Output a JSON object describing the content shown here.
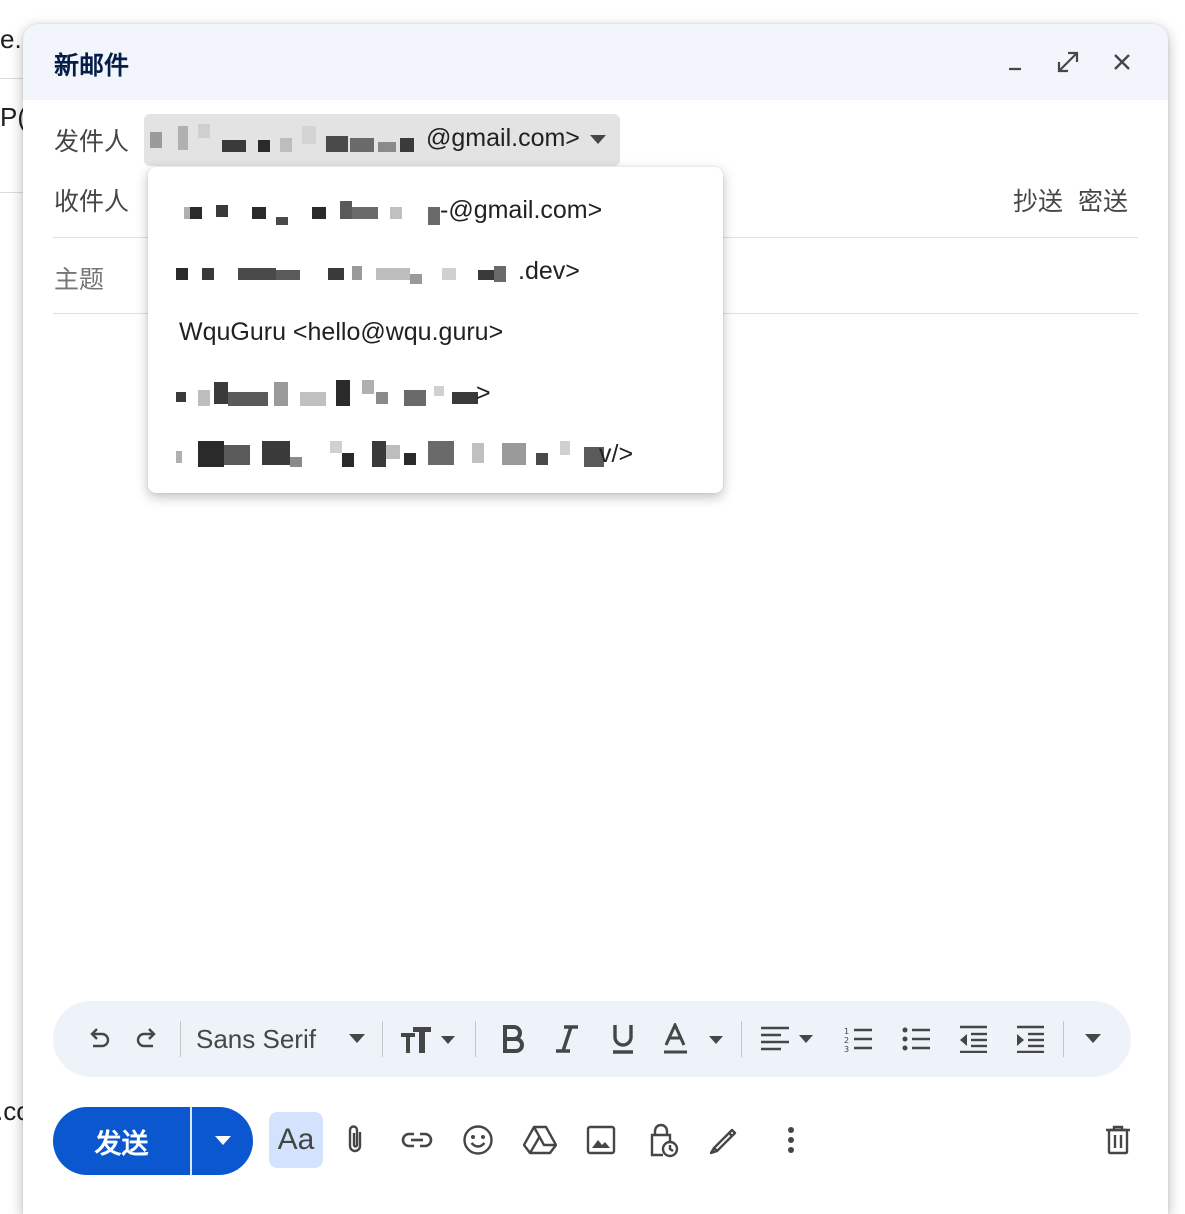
{
  "background": {
    "frag_top": "e.",
    "frag_mid": "P(",
    "frag_bottom": ".co"
  },
  "compose": {
    "title": "新邮件",
    "from_label": "发件人",
    "from_value_suffix": "@gmail.com>",
    "to_label": "收件人",
    "cc_label": "抄送",
    "bcc_label": "密送",
    "subject_placeholder": "主题"
  },
  "dropdown": {
    "items": [
      {
        "visible_text": "-@gmail.com>"
      },
      {
        "visible_text": ".dev>"
      },
      {
        "visible_text": "WquGuru <hello@wqu.guru>"
      },
      {
        "visible_text": ">"
      },
      {
        "visible_text": "v/>"
      }
    ]
  },
  "toolbar": {
    "font": "Sans Serif"
  },
  "bottom": {
    "send_label": "发送",
    "aa_label": "Aa"
  },
  "colors": {
    "primary": "#0b57d0",
    "header_bg": "#f2f6fc",
    "toolbar_bg": "#eef2f9",
    "chip_bg": "#e3e3e3"
  }
}
